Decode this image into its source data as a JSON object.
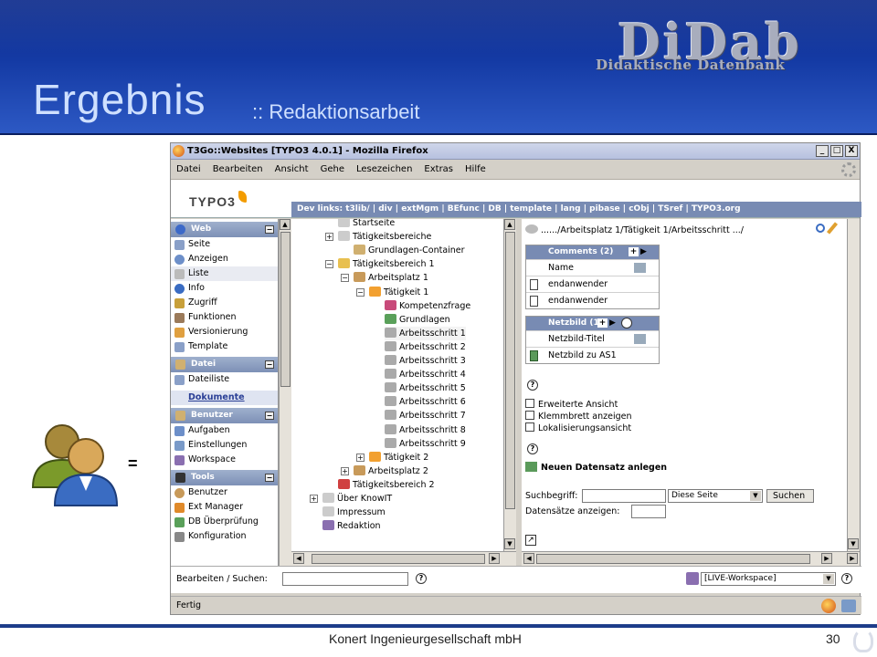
{
  "slide": {
    "title": "Ergebnis",
    "subtitle": ":: Redaktionsarbeit",
    "logo_main": "DiDab",
    "logo_sub": "Didaktische Datenbank",
    "equals": "=",
    "footer": "Konert Ingenieurgesellschaft mbH",
    "page_number": "30"
  },
  "browser": {
    "title": "T3Go::Websites [TYPO3 4.0.1] - Mozilla Firefox",
    "window_buttons": [
      "_",
      "□",
      "X"
    ],
    "menu": [
      "Datei",
      "Bearbeiten",
      "Ansicht",
      "Gehe",
      "Lesezeichen",
      "Extras",
      "Hilfe"
    ],
    "status": "Fertig"
  },
  "typo3": {
    "logo": "TYPO3",
    "dev_links": "Dev links: t3lib/ | div | extMgm | BEfunc | DB | template | lang | pibase | cObj | TSref | TYPO3.org",
    "modules": [
      {
        "group": "Web",
        "items": [
          "Seite",
          "Anzeigen",
          "Liste",
          "Info",
          "Zugriff",
          "Funktionen",
          "Versionierung",
          "Template"
        ]
      },
      {
        "group": "Datei",
        "items": [
          "Dateiliste"
        ]
      },
      {
        "group": "",
        "items": [
          "Dokumente"
        ]
      },
      {
        "group": "Benutzer",
        "items": [
          "Aufgaben",
          "Einstellungen",
          "Workspace"
        ]
      },
      {
        "group": "Tools",
        "items": [
          "Benutzer",
          "Ext Manager",
          "DB Überprüfung",
          "Konfiguration"
        ]
      }
    ],
    "tree": [
      "Startseite",
      "Tätigkeitsbereiche",
      "Grundlagen-Container",
      "Tätigkeitsbereich 1",
      "Arbeitsplatz 1",
      "Tätigkeit 1",
      "Kompetenzfrage",
      "Grundlagen",
      "Arbeitsschritt 1",
      "Arbeitsschritt 2",
      "Arbeitsschritt 3",
      "Arbeitsschritt 4",
      "Arbeitsschritt 5",
      "Arbeitsschritt 6",
      "Arbeitsschritt 7",
      "Arbeitsschritt 8",
      "Arbeitsschritt 9",
      "Tätigkeit 2",
      "Arbeitsplatz 2",
      "Tätigkeitsbereich 2",
      "Über KnowIT",
      "Impressum",
      "Redaktion"
    ],
    "breadcrumb": "....../Arbeitsplatz 1/Tätigkeit 1/Arbeitsschritt .../",
    "comments_panel": {
      "title": "Comments (2)",
      "header_col": "Name",
      "rows": [
        "endanwender",
        "endanwender"
      ]
    },
    "netzbild_panel": {
      "title": "Netzbild (1)",
      "header_col": "Netzbild-Titel",
      "rows": [
        "Netzbild zu AS1"
      ]
    },
    "options": [
      "Erweiterte Ansicht",
      "Klemmbrett anzeigen",
      "Lokalisierungsansicht"
    ],
    "new_record": "Neuen Datensatz anlegen",
    "search_label": "Suchbegriff:",
    "search_scope": "Diese Seite",
    "search_button": "Suchen",
    "records_label": "Datensätze anzeigen:",
    "edit_search_label": "Bearbeiten / Suchen:",
    "workspace_select": "[LIVE-Workspace]"
  }
}
